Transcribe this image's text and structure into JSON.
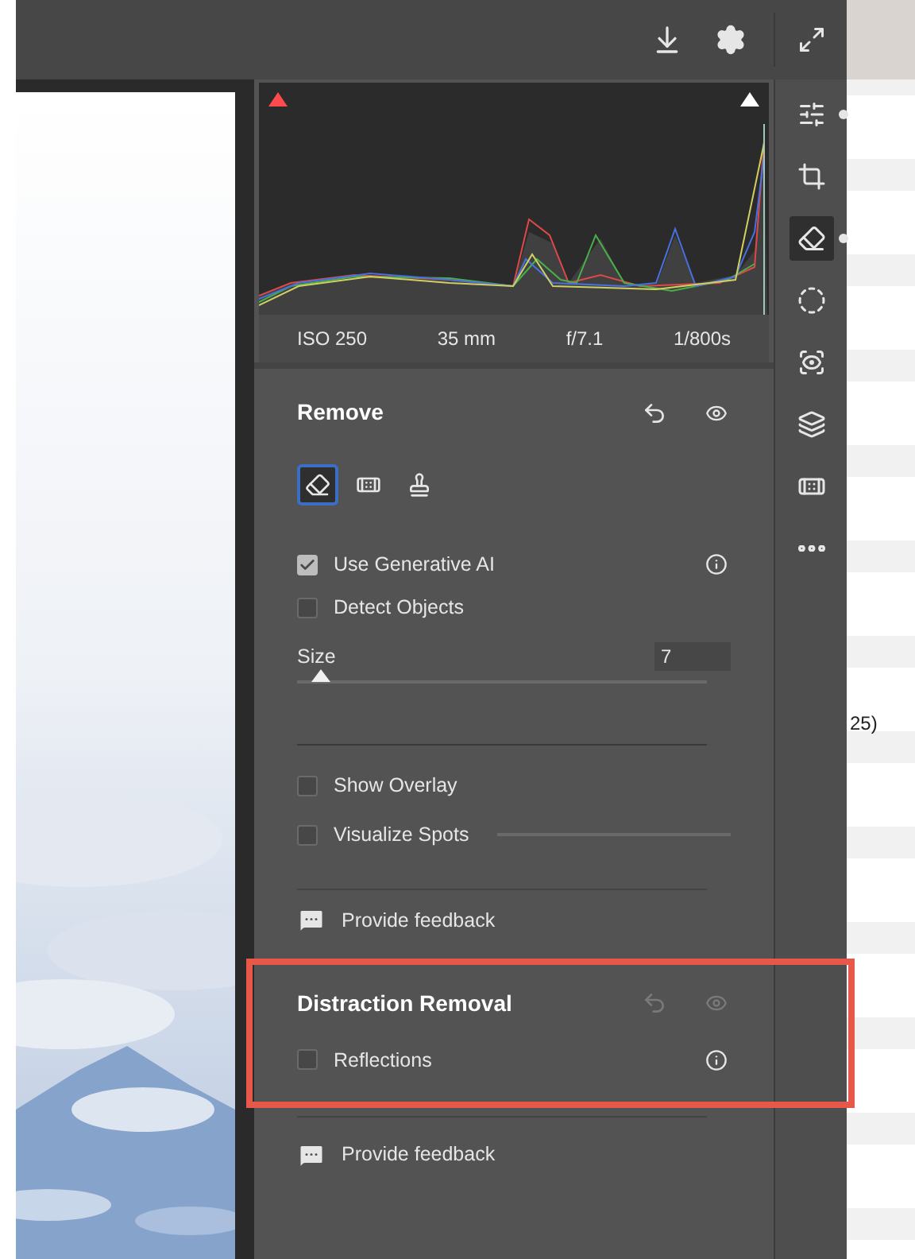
{
  "camera_info": [
    "ISO 250",
    "35 mm",
    "f/7.1",
    "1/800s"
  ],
  "tool_strip": [
    {
      "kind": "edit",
      "selected": false,
      "has_edits": true
    },
    {
      "kind": "crop",
      "selected": false,
      "has_edits": false
    },
    {
      "kind": "remove",
      "selected": true,
      "has_edits": true
    },
    {
      "kind": "masking",
      "selected": false,
      "has_edits": false
    },
    {
      "kind": "redeye",
      "selected": false,
      "has_edits": false
    },
    {
      "kind": "presets",
      "selected": false,
      "has_edits": false
    },
    {
      "kind": "heal",
      "selected": false,
      "has_edits": false
    },
    {
      "kind": "more",
      "selected": false,
      "has_edits": false
    }
  ],
  "remove": {
    "title": "Remove",
    "tools": [
      {
        "kind": "eraser",
        "selected": true
      },
      {
        "kind": "bandage",
        "selected": false
      },
      {
        "kind": "stamp",
        "selected": false
      }
    ],
    "options": [
      {
        "label": "Use Generative AI",
        "checked": true,
        "info": true
      },
      {
        "label": "Detect Objects",
        "checked": false,
        "info": false
      }
    ],
    "size": {
      "label": "Size",
      "value": "7",
      "level": 0.06
    },
    "display": [
      {
        "kind": "checkbox",
        "label": "Show Overlay",
        "checked": false
      },
      {
        "kind": "checkbox_slider",
        "label": "Visualize Spots",
        "checked": false
      }
    ],
    "feedback": "Provide feedback"
  },
  "distraction_removal": {
    "title": "Distraction Removal",
    "enabled": false,
    "highlighted": true,
    "options": [
      {
        "label": "Reflections",
        "checked": false,
        "info": true
      }
    ],
    "feedback": "Provide feedback"
  },
  "background_text": "25)"
}
